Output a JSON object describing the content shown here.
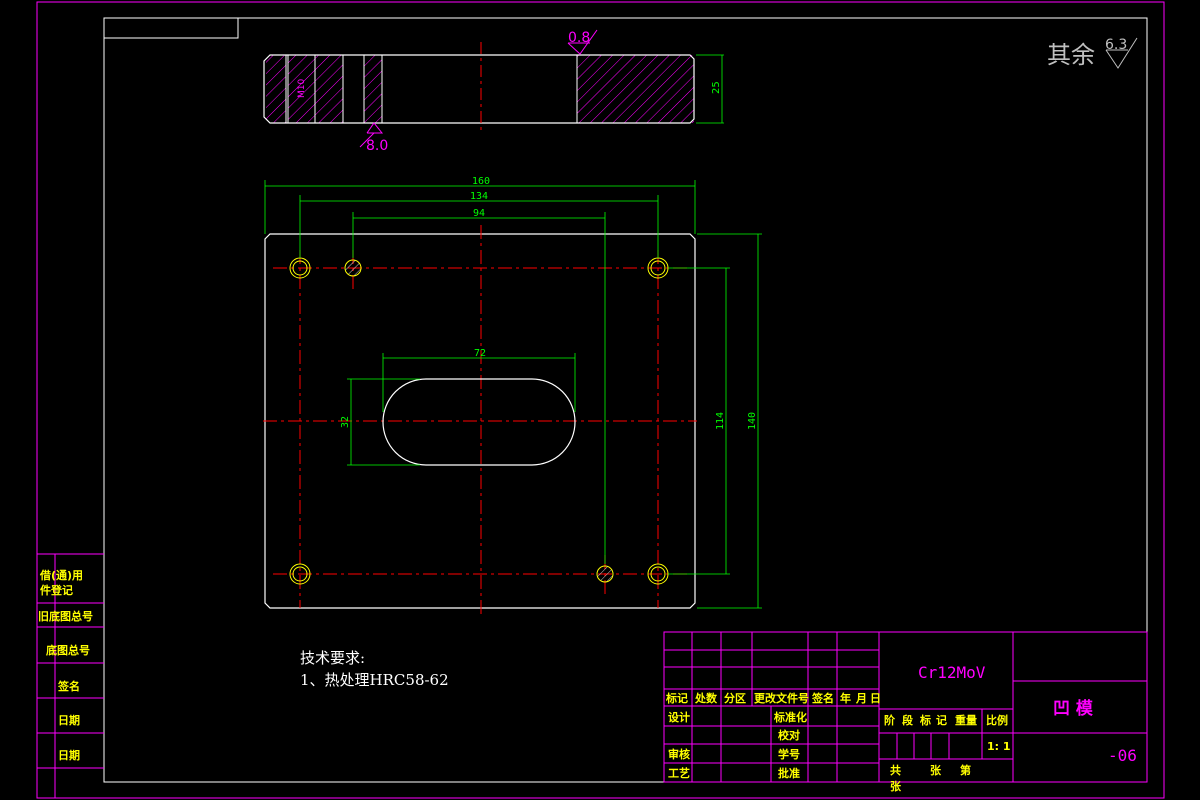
{
  "surface_finish": {
    "general_label": "其余",
    "general_value": "6.3",
    "top_value": "0.8",
    "bottom_value": "8.0"
  },
  "side_view": {
    "thread_label": "M10",
    "thickness_dim": "25"
  },
  "plan_dims": {
    "overall_width": "160",
    "hole_spacing_x": "134",
    "pin_spacing": "94",
    "slot_length": "72",
    "slot_width": "32",
    "hole_spacing_y": "114",
    "overall_height": "140"
  },
  "notes": {
    "title": "技术要求:",
    "item1": "1、热处理HRC58-62"
  },
  "left_strip": {
    "labels": [
      "借(通)用",
      "件登记",
      "旧底图总号",
      "底图总号",
      "签名",
      "日期",
      "日期"
    ]
  },
  "title_block": {
    "revision_headers": [
      "标记",
      "处数",
      "分区",
      "更改文件号",
      "签名",
      "年",
      "月",
      "日"
    ],
    "role_design": "设计",
    "role_standard": "标准化",
    "role_check_draw": "审核",
    "role_review": "审核",
    "role_craft": "工艺",
    "role_approve": "批准",
    "role_pending": "审核",
    "role_proofread": "校对",
    "material": "Cr12MoV",
    "part_name": "凹  模",
    "drawing_no": "-06",
    "stage_headers": [
      "阶",
      "段",
      "标",
      "记",
      "重量",
      "比例"
    ],
    "scale": "1: 1",
    "sheet_total": "共",
    "sheet_zhang": "张",
    "sheet_di": "第",
    "sheet_zhang2": "张",
    "role_jiaobiao": "校对",
    "role_xueshi": "学号"
  }
}
